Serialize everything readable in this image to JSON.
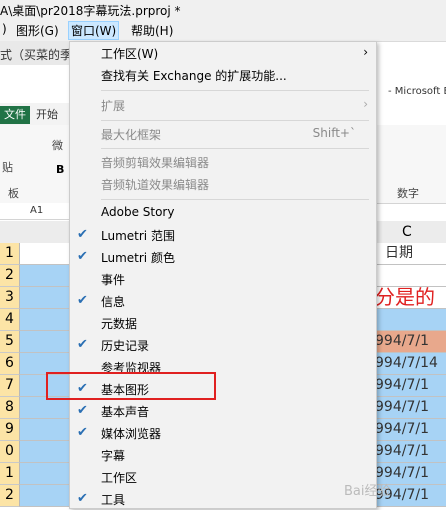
{
  "window": {
    "title": "A\\桌面\\pr2018字幕玩法.prproj *"
  },
  "menubar": {
    "items": [
      {
        "label": ")"
      },
      {
        "label": "图形(G)"
      },
      {
        "label": "窗口(W)",
        "active": true
      },
      {
        "label": "帮助(H)"
      }
    ]
  },
  "panel": {
    "text": "式（买菜的季"
  },
  "excel": {
    "title": "- Microsoft Ex",
    "file_tab": "文件",
    "home_tab": "开始",
    "ribbon_left": [
      "微",
      "B",
      "贴",
      "板"
    ],
    "name_box": "A1",
    "number_group": "数字",
    "col_C": "C",
    "header_cell": "日期",
    "red_text": "分是的",
    "rows": [
      "1",
      "2",
      "3",
      "4",
      "5",
      "6",
      "7",
      "8",
      "9",
      "0",
      "1",
      "2"
    ],
    "c_values": [
      "",
      "日期",
      "",
      "",
      "994/7/1",
      "994/7/14",
      "994/7/1",
      "994/7/1",
      "994/7/1",
      "994/7/1",
      "994/7/1",
      "994/7/1"
    ]
  },
  "menu": {
    "items": [
      {
        "label": "工作区(W)",
        "submenu": true,
        "disabled": false
      },
      {
        "label": "查找有关 Exchange 的扩展功能...",
        "disabled": false
      },
      {
        "label": "扩展",
        "submenu": true,
        "disabled": true
      },
      {
        "label": "最大化框架",
        "shortcut": "Shift+`",
        "disabled": true
      },
      {
        "label": "音频剪辑效果编辑器",
        "disabled": true
      },
      {
        "label": "音频轨道效果编辑器",
        "disabled": true
      },
      {
        "label": "Adobe Story",
        "disabled": false
      },
      {
        "label": "Lumetri 范围",
        "checked": true
      },
      {
        "label": "Lumetri 颜色",
        "checked": true
      },
      {
        "label": "事件"
      },
      {
        "label": "信息",
        "checked": true
      },
      {
        "label": "元数据"
      },
      {
        "label": "历史记录",
        "checked": true
      },
      {
        "label": "参考监视器"
      },
      {
        "label": "基本图形",
        "checked": true,
        "highlighted": true
      },
      {
        "label": "基本声音",
        "checked": true
      },
      {
        "label": "媒体浏览器",
        "checked": true
      },
      {
        "label": "字幕"
      },
      {
        "label": "工作区"
      },
      {
        "label": "工具",
        "checked": true
      }
    ]
  },
  "watermark": "Bai经验",
  "colors": {
    "accent": "#2a6fb3",
    "highlight_box": "#e02020",
    "excel_green": "#217346",
    "row_header": "#fce4a6",
    "cell_fill": "#a7d3f5"
  }
}
